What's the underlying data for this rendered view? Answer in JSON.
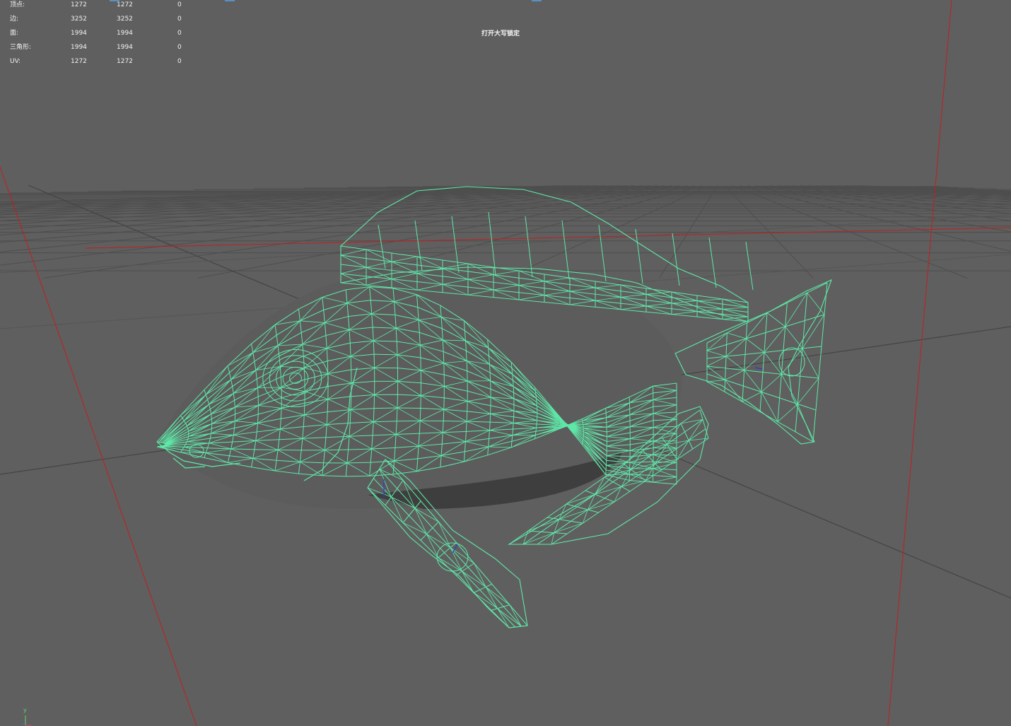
{
  "stats": {
    "rows": [
      {
        "label": "顶点:",
        "c1": "1272",
        "c2": "1272",
        "c3": "0"
      },
      {
        "label": "边:",
        "c1": "3252",
        "c2": "3252",
        "c3": "0"
      },
      {
        "label": "面:",
        "c1": "1994",
        "c2": "1994",
        "c3": "0"
      },
      {
        "label": "三角形:",
        "c1": "1994",
        "c2": "1994",
        "c3": "0"
      },
      {
        "label": "UV:",
        "c1": "1272",
        "c2": "1272",
        "c3": "0"
      }
    ]
  },
  "viewport": {
    "caps_lock_message": "打开大写锁定",
    "background_color": "#5f5f5f",
    "grid_color": "#4e4e4e",
    "grid_light_color": "#6a6a6a",
    "axis_color": "#c21f1f",
    "wireframe_color": "#5fe8a8",
    "axis_widget_label": "y"
  },
  "model": {
    "name_icon": "fish-wireframe",
    "selected": true
  }
}
